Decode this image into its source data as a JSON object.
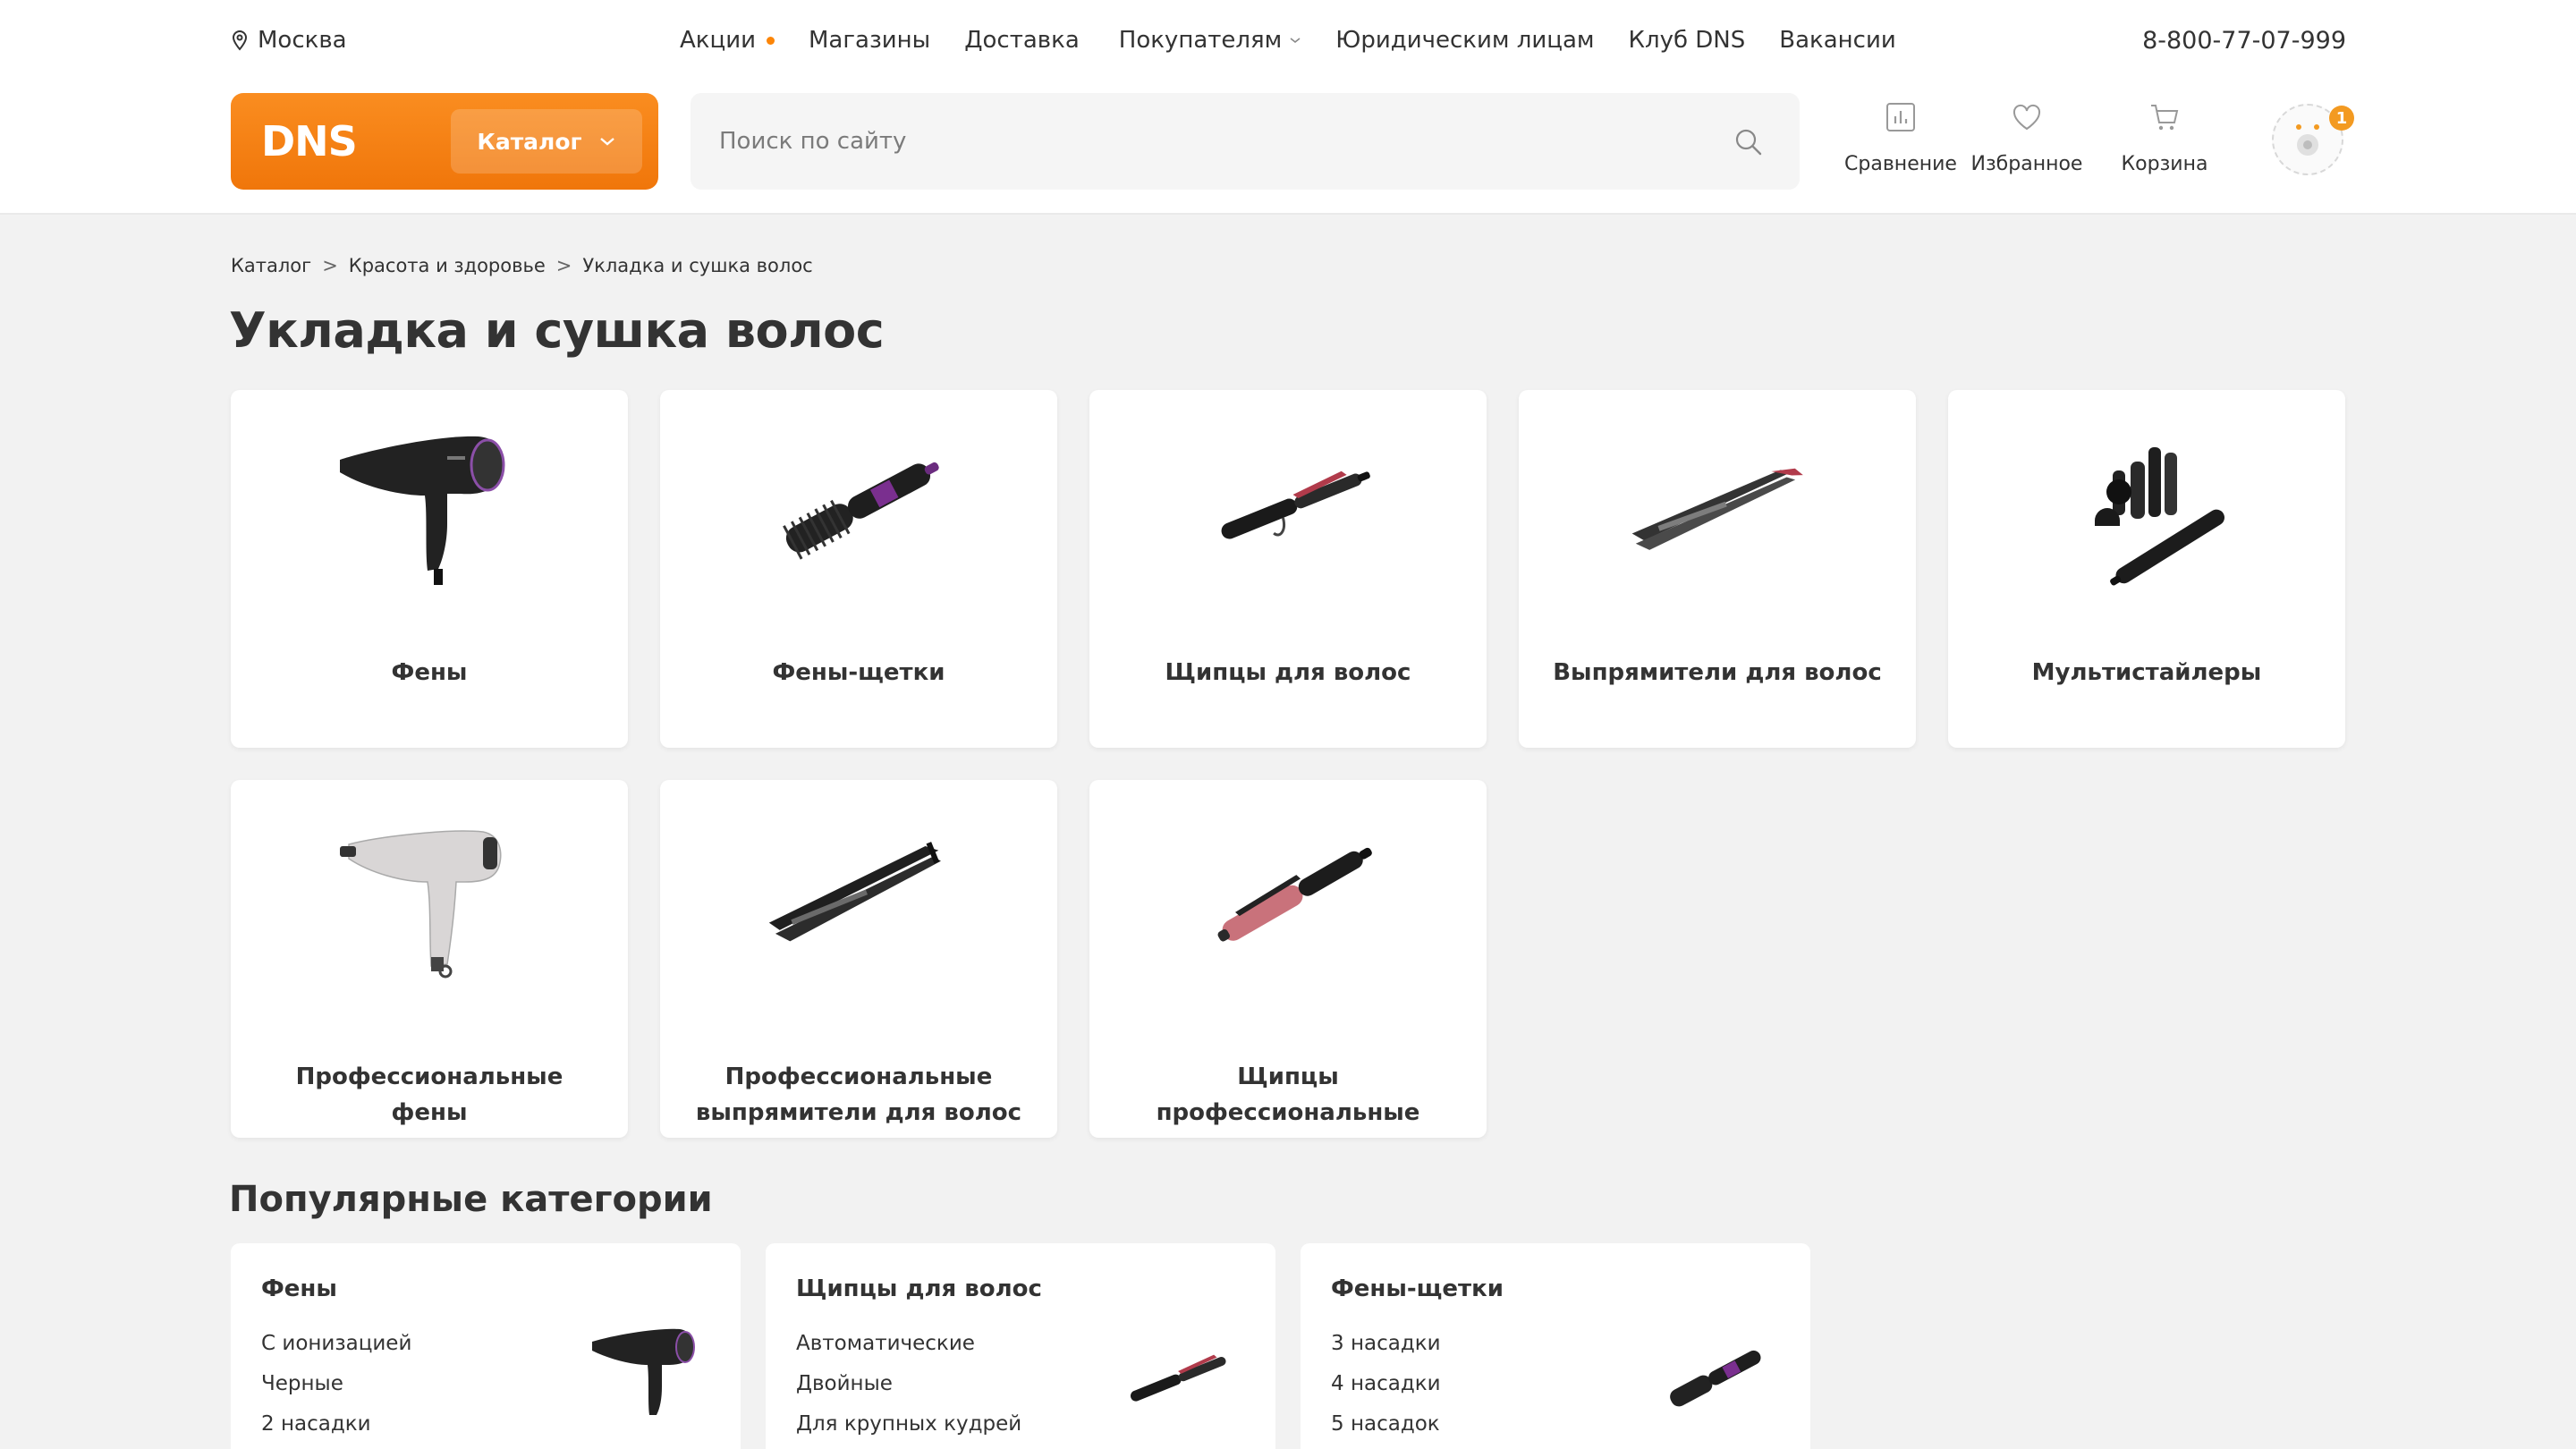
{
  "header": {
    "city": "Москва",
    "nav": [
      {
        "label": "Акции",
        "has_dot": true
      },
      {
        "label": "Магазины"
      },
      {
        "label": "Доставка"
      },
      {
        "label": "Покупателям",
        "has_chevron": true
      },
      {
        "label": "Юридическим лицам"
      },
      {
        "label": "Клуб DNS"
      },
      {
        "label": "Вакансии"
      }
    ],
    "phone": "8-800-77-07-999",
    "logo": "DNS",
    "catalog_label": "Каталог",
    "search_placeholder": "Поиск по сайту",
    "tools": {
      "compare": "Сравнение",
      "favorites": "Избранное",
      "cart": "Корзина"
    },
    "avatar_badge": "1"
  },
  "breadcrumb": [
    "Каталог",
    "Красота и здоровье",
    "Укладка и сушка волос"
  ],
  "page_title": "Укладка и сушка волос",
  "categories": [
    {
      "label": "Фены",
      "icon": "hair-dryer-icon"
    },
    {
      "label": "Фены-щетки",
      "icon": "hot-air-brush-icon"
    },
    {
      "label": "Щипцы для волос",
      "icon": "curling-iron-icon"
    },
    {
      "label": "Выпрямители для волос",
      "icon": "hair-straightener-icon"
    },
    {
      "label": "Мультистайлеры",
      "icon": "multistyler-icon"
    },
    {
      "label_lines": [
        "Профессиональные",
        "фены"
      ],
      "icon": "pro-hair-dryer-icon"
    },
    {
      "label_lines": [
        "Профессиональные",
        "выпрямители для волос"
      ],
      "icon": "pro-straightener-icon"
    },
    {
      "label_lines": [
        "Щипцы",
        "профессиональные"
      ],
      "icon": "pro-curling-iron-icon"
    }
  ],
  "popular_title": "Популярные категории",
  "popular": [
    {
      "title": "Фены",
      "items": [
        "С ионизацией",
        "Черные",
        "2 насадки"
      ],
      "icon": "hair-dryer-icon"
    },
    {
      "title": "Щипцы для волос",
      "items": [
        "Автоматические",
        "Двойные",
        "Для крупных кудрей"
      ],
      "icon": "curling-iron-icon"
    },
    {
      "title": "Фены-щетки",
      "items": [
        "3 насадки",
        "4 насадки",
        "5 насадок"
      ],
      "icon": "hot-air-brush-icon"
    }
  ],
  "colors": {
    "brand_orange": "#f7821b",
    "background": "#f2f2f2",
    "text": "#333333",
    "accent_dot": "#fc8507"
  }
}
